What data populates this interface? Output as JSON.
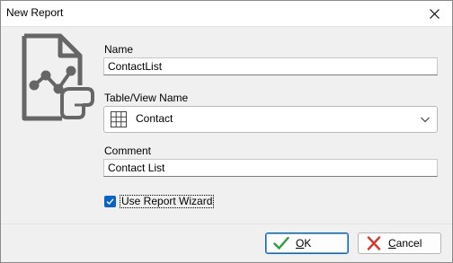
{
  "window": {
    "title": "New Report"
  },
  "form": {
    "name_label": "Name",
    "name_value": "ContactList",
    "table_label": "Table/View Name",
    "table_value": "Contact",
    "comment_label": "Comment",
    "comment_value": "Contact List",
    "wizard_label": "Use Report Wizard",
    "wizard_checked": true
  },
  "buttons": {
    "ok_first": "O",
    "ok_rest": "K",
    "cancel_first": "C",
    "cancel_rest": "ancel"
  },
  "colors": {
    "accent": "#0a64c4",
    "ok_icon": "#2e9e3b",
    "cancel_icon": "#d03a2f",
    "icon_gray": "#666666"
  },
  "icons": {
    "report": "report-chart-icon",
    "table": "table-grid-icon",
    "close": "close-icon",
    "dropdown": "chevron-down-icon",
    "ok": "checkmark-icon",
    "cancel": "cross-icon"
  }
}
